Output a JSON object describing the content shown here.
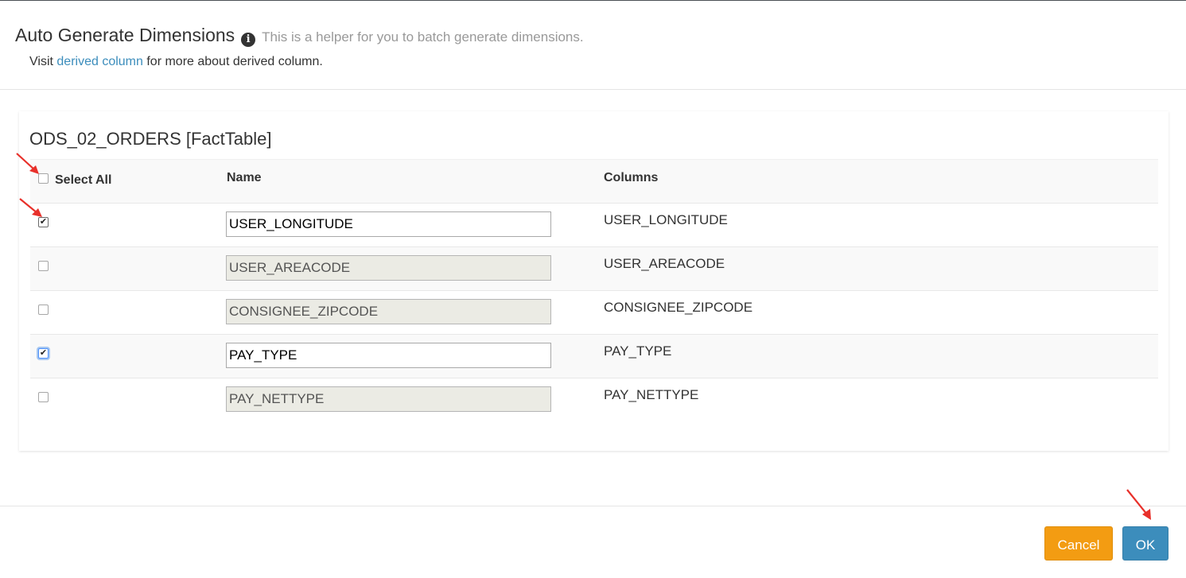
{
  "header": {
    "title": "Auto Generate Dimensions",
    "helper": "This is a helper for you to batch generate dimensions.",
    "visit_prefix": "Visit",
    "visit_link": "derived column",
    "visit_suffix": "for more about derived column."
  },
  "panel": {
    "title": "ODS_02_ORDERS [FactTable]"
  },
  "table": {
    "select_all_label": "Select All",
    "select_all_checked": false,
    "name_header": "Name",
    "columns_header": "Columns",
    "rows": [
      {
        "checked": true,
        "name": "USER_LONGITUDE",
        "column": "USER_LONGITUDE"
      },
      {
        "checked": false,
        "name": "USER_AREACODE",
        "column": "USER_AREACODE"
      },
      {
        "checked": false,
        "name": "CONSIGNEE_ZIPCODE",
        "column": "CONSIGNEE_ZIPCODE"
      },
      {
        "checked": true,
        "name": "PAY_TYPE",
        "column": "PAY_TYPE"
      },
      {
        "checked": false,
        "name": "PAY_NETTYPE",
        "column": "PAY_NETTYPE"
      }
    ]
  },
  "footer": {
    "cancel_label": "Cancel",
    "ok_label": "OK"
  },
  "colors": {
    "link": "#3c8dbc",
    "cancel": "#f39c12",
    "ok": "#3c8dbc",
    "annotation_arrow": "#e8302a"
  },
  "icons": {
    "info": "info-circle-icon",
    "annotation": "red-arrow-icon"
  }
}
